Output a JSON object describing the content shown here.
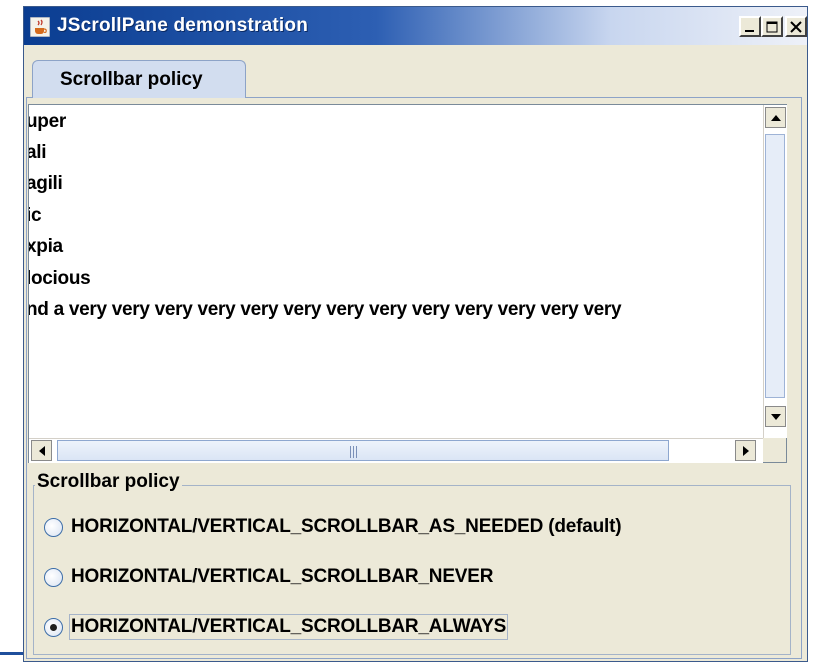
{
  "window": {
    "title": "JScrollPane demonstration",
    "icons": {
      "app": "java-cup-icon",
      "minimize": "minimize-icon",
      "maximize": "maximize-icon",
      "close": "close-icon"
    },
    "colors": {
      "titlebar_start": "#0a3d91",
      "titlebar_end": "#eef1f8",
      "face": "#ece9d8"
    }
  },
  "tabs": [
    {
      "label": "Scrollbar policy",
      "selected": true
    }
  ],
  "text_area": {
    "lines": [
      "uper",
      "ali",
      "agili",
      "ic",
      "xpia",
      "locious",
      "nd a very very very very very very very very very very very very very"
    ]
  },
  "scrollbars": {
    "vertical": {
      "up_icon": "arrow-up-icon",
      "down_icon": "arrow-down-icon"
    },
    "horizontal": {
      "left_icon": "arrow-left-icon",
      "right_icon": "arrow-right-icon",
      "grip_icon": "grip-icon"
    }
  },
  "policy_group": {
    "title": "Scrollbar policy",
    "options": [
      {
        "label": "HORIZONTAL/VERTICAL_SCROLLBAR_AS_NEEDED (default)",
        "selected": false
      },
      {
        "label": "HORIZONTAL/VERTICAL_SCROLLBAR_NEVER",
        "selected": false
      },
      {
        "label": "HORIZONTAL/VERTICAL_SCROLLBAR_ALWAYS",
        "selected": true
      }
    ]
  }
}
